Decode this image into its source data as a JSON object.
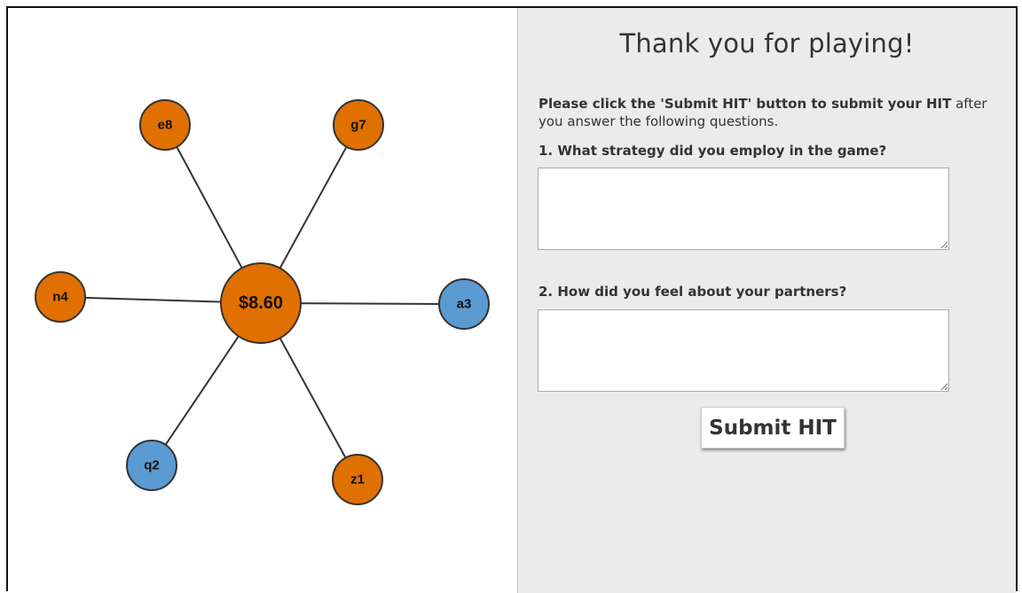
{
  "graph": {
    "center": {
      "label": "$8.60",
      "color": "#e07000"
    },
    "partners": [
      {
        "id": "e8",
        "label": "e8",
        "color": "#e07000"
      },
      {
        "id": "g7",
        "label": "g7",
        "color": "#e07000"
      },
      {
        "id": "n4",
        "label": "n4",
        "color": "#e07000"
      },
      {
        "id": "a3",
        "label": "a3",
        "color": "#5b9bd1"
      },
      {
        "id": "q2",
        "label": "q2",
        "color": "#5b9bd1"
      },
      {
        "id": "z1",
        "label": "z1",
        "color": "#e07000"
      }
    ],
    "edge_color": "#333333",
    "node_stroke": "#333333"
  },
  "survey": {
    "title": "Thank you for playing!",
    "instructions_bold": "Please click the 'Submit HIT' button to submit your HIT",
    "instructions_rest": " after you answer the following questions.",
    "questions": [
      {
        "label": "1. What strategy did you employ in the game?",
        "answer": ""
      },
      {
        "label": "2. How did you feel about your partners?",
        "answer": ""
      }
    ],
    "submit_label": "Submit HIT"
  }
}
